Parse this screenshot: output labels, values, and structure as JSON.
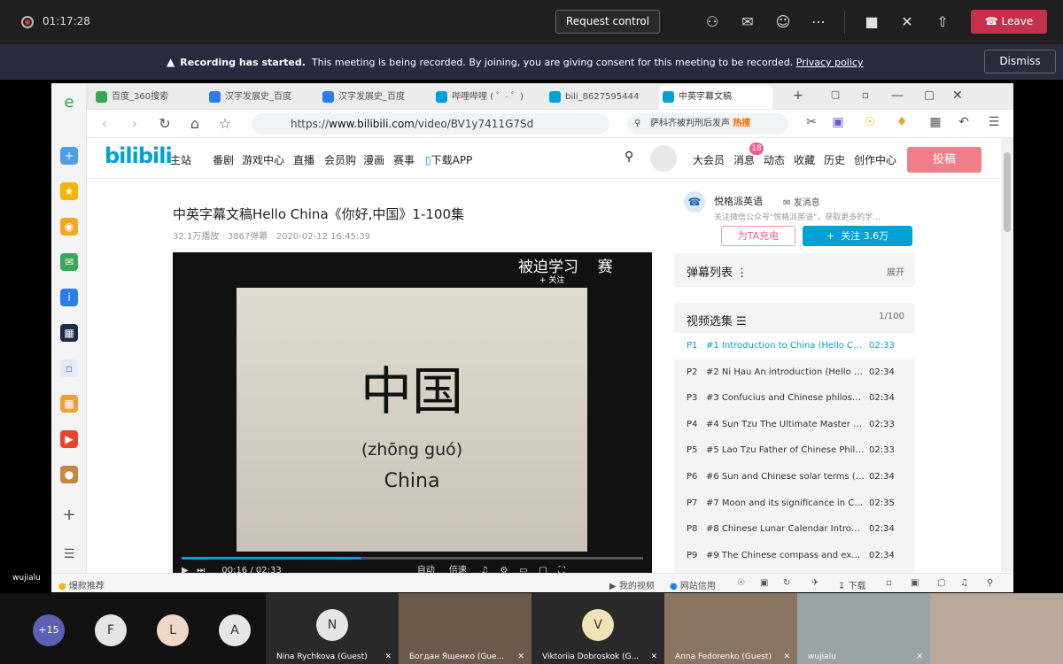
{
  "meeting": {
    "timer": "01:17:28",
    "request_control": "Request control",
    "leave": "Leave"
  },
  "banner": {
    "bold": "Recording has started.",
    "text": "This meeting is being recorded. By joining, you are giving consent for this meeting to be recorded.",
    "privacy_link": "Privacy policy",
    "dismiss": "Dismiss"
  },
  "browser": {
    "tabs": [
      {
        "label": "百度_360搜索"
      },
      {
        "label": "汉字发展史_百度"
      },
      {
        "label": "汉字发展史_百度"
      },
      {
        "label": "哔哩哔哩 ( ゜- ゜)"
      },
      {
        "label": "bili_8627595444"
      },
      {
        "label": "中英字幕文稿"
      }
    ],
    "url_prefix": "https://",
    "url_domain": "www.bilibili.com",
    "url_path": "/video/BV1y7411G7Sd",
    "search_text": "萨科齐被判刑后发声",
    "search_hot": "热搜"
  },
  "bili": {
    "logo": "bilibili",
    "nav_left": [
      "主站",
      "番剧",
      "游戏中心",
      "直播",
      "会员购",
      "漫画",
      "赛事",
      "下载APP"
    ],
    "nav_right": [
      "大会员",
      "消息",
      "动态",
      "收藏",
      "历史",
      "创作中心"
    ],
    "message_badge": "18",
    "upload": "投稿"
  },
  "video": {
    "title": "中英字幕文稿Hello China《你好,中国》1-100集",
    "views": "32.1万播放",
    "danmaku_count": "3867弹幕",
    "date": "2020-02-12 16:45:39",
    "overlay_text": "被迫学习",
    "overlay_text_2": "赛",
    "follow_mini": "+ 关注",
    "hanzi": "中国",
    "pinyin": "(zhōng guó)",
    "english": "China",
    "time_current": "00:16",
    "time_total": "02:33",
    "auto_label": "自动",
    "speed_label": "倍速",
    "progress": 0.39
  },
  "uploader": {
    "name": "悦格派英语",
    "message": "发消息",
    "desc": "关注微信公众号\"悦格派英语\"，获取更多的学...",
    "charge": "为TA充电",
    "follow": "关注 3.6万"
  },
  "danmaku_panel": {
    "title": "弹幕列表",
    "expand": "展开"
  },
  "episodes_panel": {
    "title": "视频选集",
    "count": "1/100",
    "items": [
      {
        "code": "P1",
        "title": "#1 Introduction to China (Hello Chi...",
        "duration": "02:33",
        "active": true
      },
      {
        "code": "P2",
        "title": "#2 Ni Hau An introduction (Hello China)",
        "duration": "02:34",
        "active": false
      },
      {
        "code": "P3",
        "title": "#3 Confucius and Chinese philosophy...",
        "duration": "02:34",
        "active": false
      },
      {
        "code": "P4",
        "title": "#4 Sun Tzu The Ultimate Master of W...",
        "duration": "02:33",
        "active": false
      },
      {
        "code": "P5",
        "title": "#5 Lao Tzu Father of Chinese Philoso...",
        "duration": "02:33",
        "active": false
      },
      {
        "code": "P6",
        "title": "#6 Sun and Chinese solar terms (Hell...",
        "duration": "02:34",
        "active": false
      },
      {
        "code": "P7",
        "title": "#7 Moon and its significance in Chine...",
        "duration": "02:35",
        "active": false
      },
      {
        "code": "P8",
        "title": "#8 Chinese Lunar Calendar Introducti...",
        "duration": "02:34",
        "active": false
      },
      {
        "code": "P9",
        "title": "#9 The Chinese compass and explore...",
        "duration": "02:34",
        "active": false
      }
    ]
  },
  "statusbar": {
    "left": "爆款推荐",
    "my_video": "我的视频",
    "site_trust": "网站信用",
    "download": "下载"
  },
  "participants": {
    "overflow": "+15",
    "initials": [
      "F",
      "L",
      "A"
    ],
    "self_label": "wujialu",
    "tiles": [
      {
        "initial": "N",
        "name": "Nina Rychkova (Guest)"
      },
      {
        "initial": "",
        "name": "Богдан Ященко (Gue..."
      },
      {
        "initial": "V",
        "name": "Viktoriia Dobroskok (G..."
      },
      {
        "initial": "",
        "name": "Anna Fedorenko (Guest)"
      },
      {
        "initial": "",
        "name": "wujialu"
      },
      {
        "initial": "",
        "name": ""
      }
    ]
  }
}
